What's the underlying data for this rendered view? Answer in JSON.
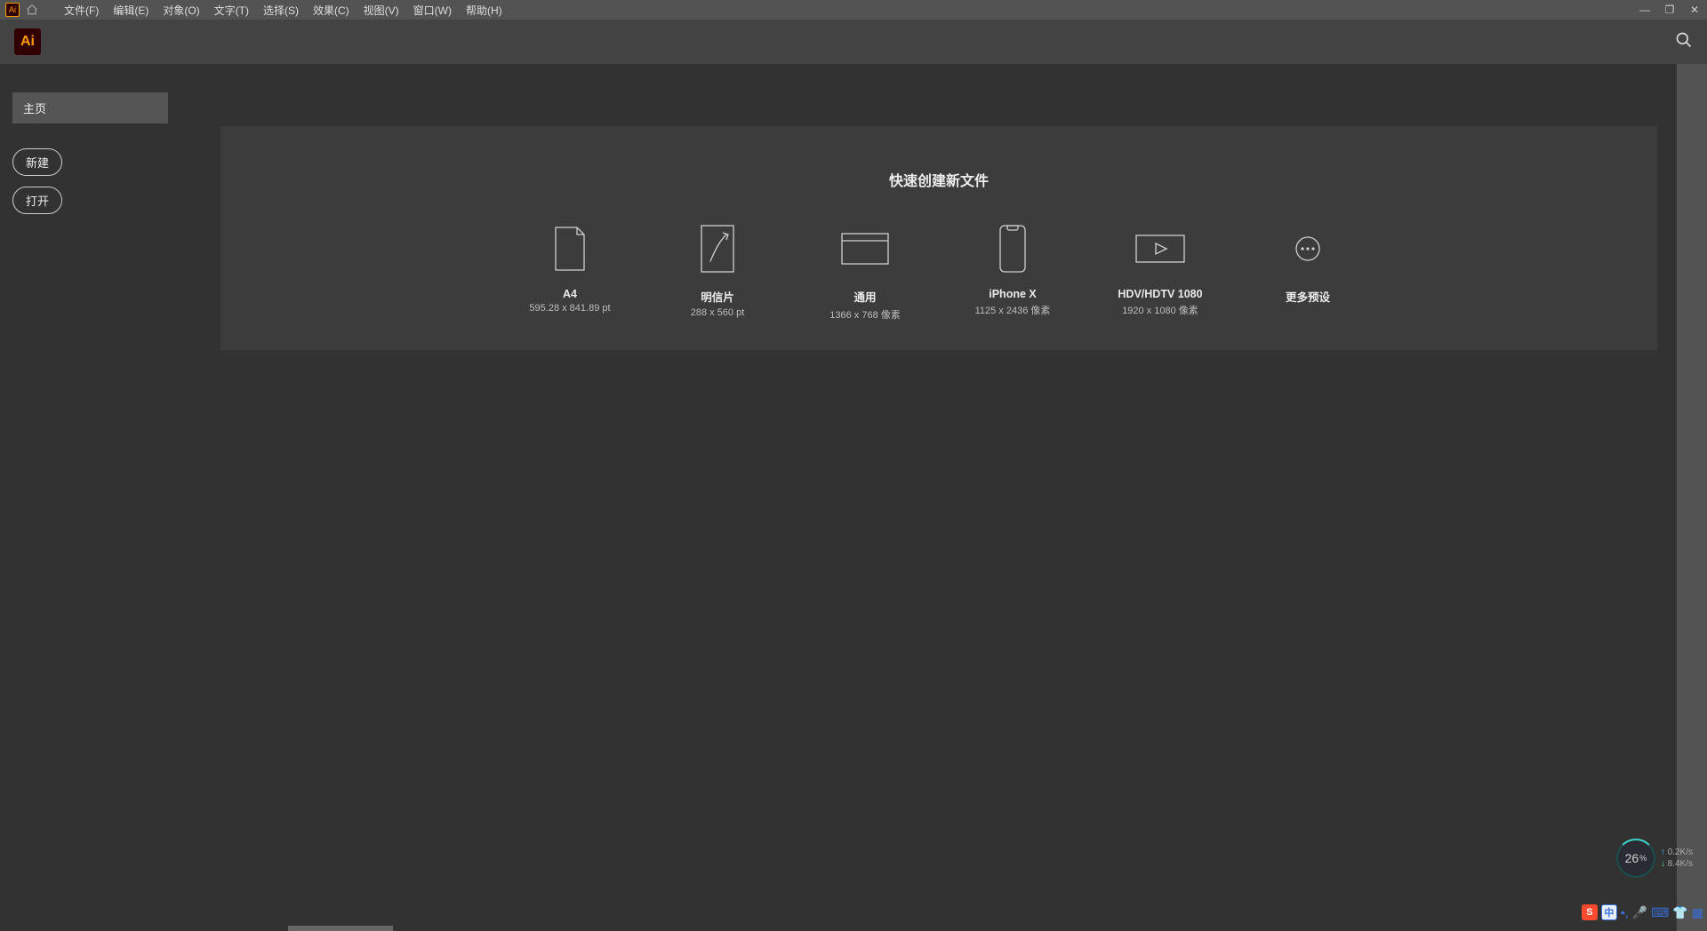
{
  "menubar": {
    "items": [
      "文件(F)",
      "编辑(E)",
      "对象(O)",
      "文字(T)",
      "选择(S)",
      "效果(C)",
      "视图(V)",
      "窗口(W)",
      "帮助(H)"
    ]
  },
  "appbar": {
    "logo_text": "Ai"
  },
  "sidebar": {
    "home_tab": "主页",
    "new_button": "新建",
    "open_button": "打开"
  },
  "main": {
    "heading": "快速创建新文件",
    "presets": [
      {
        "title": "A4",
        "subtitle": "595.28 x 841.89 pt"
      },
      {
        "title": "明信片",
        "subtitle": "288 x 560 pt"
      },
      {
        "title": "通用",
        "subtitle": "1366 x 768 像素"
      },
      {
        "title": "iPhone X",
        "subtitle": "1125 x 2436 像素"
      },
      {
        "title": "HDV/HDTV 1080",
        "subtitle": "1920 x 1080 像素"
      },
      {
        "title": "更多预设",
        "subtitle": ""
      }
    ]
  },
  "netwidget": {
    "percent": "26",
    "percent_unit": "%",
    "up_rate": "0.2K/s",
    "down_rate": "8.4K/s"
  },
  "tray": {
    "ime_logo": "S",
    "ime_lang": "中"
  }
}
